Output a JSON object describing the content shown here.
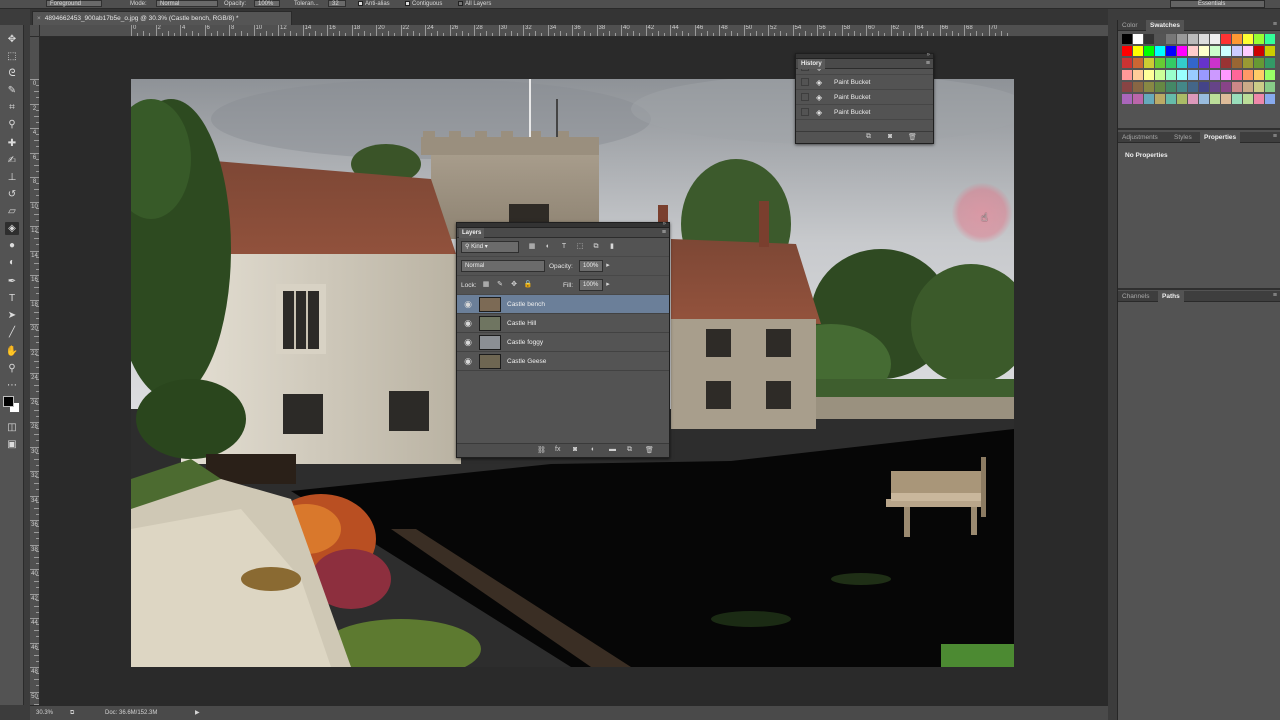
{
  "options_bar": {
    "tool_preset": "Foreground",
    "mode_label": "Mode:",
    "mode_value": "Normal",
    "opacity_label": "Opacity:",
    "opacity_value": "100%",
    "tolerance_label": "Toleran...",
    "tolerance_value": "32",
    "anti_alias_label": "Anti-alias",
    "contiguous_label": "Contiguous",
    "all_layers_label": "All Layers",
    "workspace": "Essentials"
  },
  "document": {
    "tab_title": "4894662453_900ab17b5e_o.jpg @ 30.3% (Castle bench, RGB/8) *",
    "close_glyph": "×"
  },
  "rulers": {
    "top_labels": [
      "0",
      "2",
      "4",
      "6",
      "8",
      "10",
      "12",
      "14",
      "16",
      "18",
      "20",
      "22",
      "24",
      "26",
      "28",
      "30",
      "32",
      "34",
      "36",
      "38",
      "40",
      "42",
      "44",
      "46",
      "48",
      "50",
      "52",
      "54",
      "56",
      "58",
      "60",
      "62",
      "64",
      "66",
      "68",
      "70"
    ],
    "left_labels": [
      "0",
      "2",
      "4",
      "6",
      "8",
      "10",
      "12",
      "14",
      "16",
      "18",
      "20",
      "22",
      "24",
      "26",
      "28",
      "30",
      "32",
      "34",
      "36",
      "38",
      "40",
      "42",
      "44",
      "46",
      "48",
      "50"
    ]
  },
  "status_bar": {
    "zoom": "30.3%",
    "doc_info": "Doc: 36.6M/152.3M",
    "arrow": "▶"
  },
  "history_panel": {
    "title": "History",
    "items": [
      {
        "label": "Paint Bucket",
        "partial": true
      },
      {
        "label": "Paint Bucket"
      },
      {
        "label": "Paint Bucket"
      },
      {
        "label": "Paint Bucket"
      }
    ]
  },
  "layers_panel": {
    "title": "Layers",
    "filter_kind": "Kind",
    "blend_mode": "Normal",
    "opacity_label": "Opacity:",
    "opacity_value": "100%",
    "lock_label": "Lock:",
    "fill_label": "Fill:",
    "fill_value": "100%",
    "layers": [
      {
        "name": "Castle bench",
        "selected": true,
        "thumb_color": "#7c6a55"
      },
      {
        "name": "Castle Hill",
        "selected": false,
        "thumb_color": "#6f7561"
      },
      {
        "name": "Castle foggy",
        "selected": false,
        "thumb_color": "#8b8f94"
      },
      {
        "name": "Castle Geese",
        "selected": false,
        "thumb_color": "#6e6652"
      }
    ]
  },
  "dock": {
    "top_tabs": [
      "Color",
      "Swatches"
    ],
    "active_top_tab": "Swatches",
    "middle_tabs": [
      "Adjustments",
      "Styles",
      "Properties"
    ],
    "active_middle_tab": "Properties",
    "properties_text": "No Properties",
    "bottom_tabs": [
      "Channels",
      "Paths"
    ],
    "active_bottom_tab": "Paths"
  },
  "colors": {
    "selected_layer": "#6b7f99",
    "cursor_highlight": "#e87a8c"
  }
}
